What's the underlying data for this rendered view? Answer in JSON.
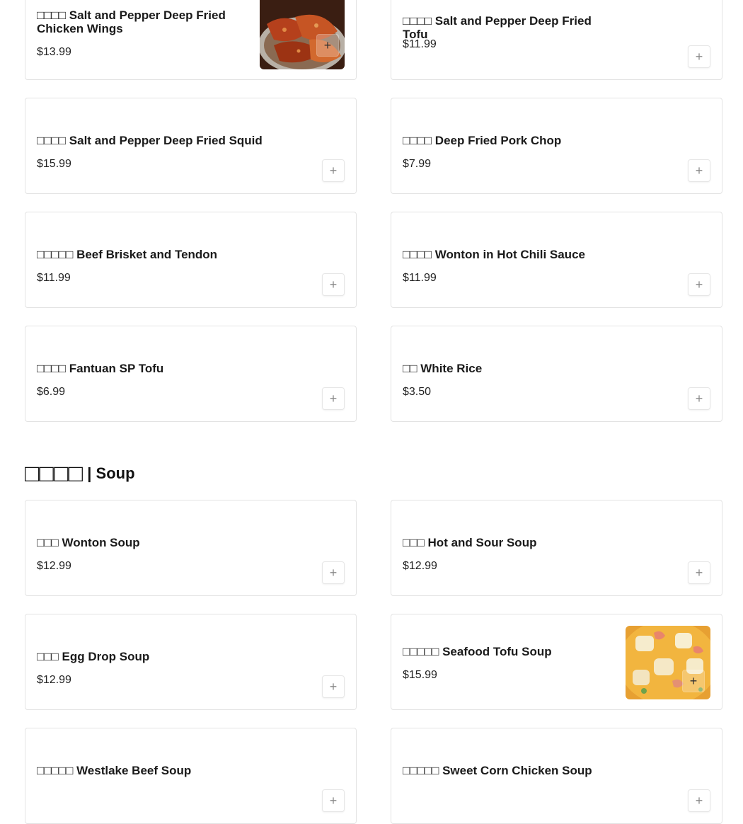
{
  "items": [
    {
      "name": "□□□□ Salt and Pepper Deep Fried Chicken Wings",
      "price": "$13.99",
      "image": "chicken-wings-photo"
    },
    {
      "name": "□□□□ Salt and Pepper Deep Fried Tofu",
      "price": "$11.99"
    },
    {
      "name": "□□□□ Salt and Pepper Deep Fried Squid",
      "price": "$15.99"
    },
    {
      "name": "□□□□ Deep Fried Pork Chop",
      "price": "$7.99"
    },
    {
      "name": "□□□□□ Beef Brisket and Tendon",
      "price": "$11.99"
    },
    {
      "name": "□□□□ Wonton in Hot Chili Sauce",
      "price": "$11.99"
    },
    {
      "name": "□□□□ Fantuan SP Tofu",
      "price": "$6.99"
    },
    {
      "name": "□□ White Rice",
      "price": "$3.50"
    }
  ],
  "section": {
    "title_zh": "□□□□",
    "title_en": "| Soup"
  },
  "soup_items": [
    {
      "name": "□□□ Wonton Soup",
      "price": "$12.99"
    },
    {
      "name": "□□□ Hot and Sour Soup",
      "price": "$12.99"
    },
    {
      "name": "□□□ Egg Drop Soup",
      "price": "$12.99"
    },
    {
      "name": "□□□□□ Seafood Tofu Soup",
      "price": "$15.99",
      "image": "seafood-tofu-soup-photo"
    },
    {
      "name": "□□□□□ Westlake Beef Soup",
      "price": ""
    },
    {
      "name": "□□□□□ Sweet Corn Chicken Soup",
      "price": ""
    }
  ],
  "icons": {
    "add": "plus-icon"
  },
  "add_symbol": "+"
}
